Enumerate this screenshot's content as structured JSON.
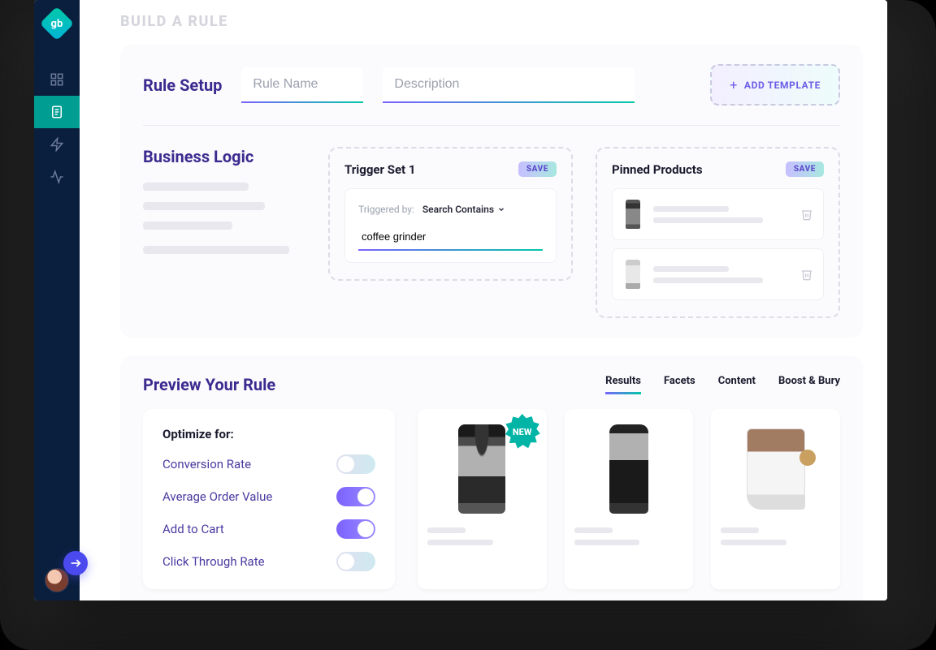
{
  "page_title": "BUILD A RULE",
  "logo_text": "gb",
  "setup": {
    "label": "Rule Setup",
    "rule_name_placeholder": "Rule Name",
    "description_placeholder": "Description",
    "add_template_label": "ADD TEMPLATE"
  },
  "business": {
    "label": "Business Logic",
    "trigger": {
      "title": "Trigger Set 1",
      "save": "SAVE",
      "triggered_by_label": "Triggered by:",
      "mode": "Search Contains",
      "value": "coffee grinder"
    },
    "pinned": {
      "title": "Pinned Products",
      "save": "SAVE"
    }
  },
  "preview": {
    "label": "Preview Your Rule",
    "tabs": {
      "results": "Results",
      "facets": "Facets",
      "content": "Content",
      "boost": "Boost & Bury"
    },
    "optimize": {
      "title": "Optimize for:",
      "options": [
        {
          "label": "Conversion Rate",
          "on": false
        },
        {
          "label": "Average Order Value",
          "on": true
        },
        {
          "label": "Add to Cart",
          "on": true
        },
        {
          "label": "Click Through Rate",
          "on": false
        }
      ]
    },
    "products": {
      "new_badge": "NEW"
    }
  }
}
